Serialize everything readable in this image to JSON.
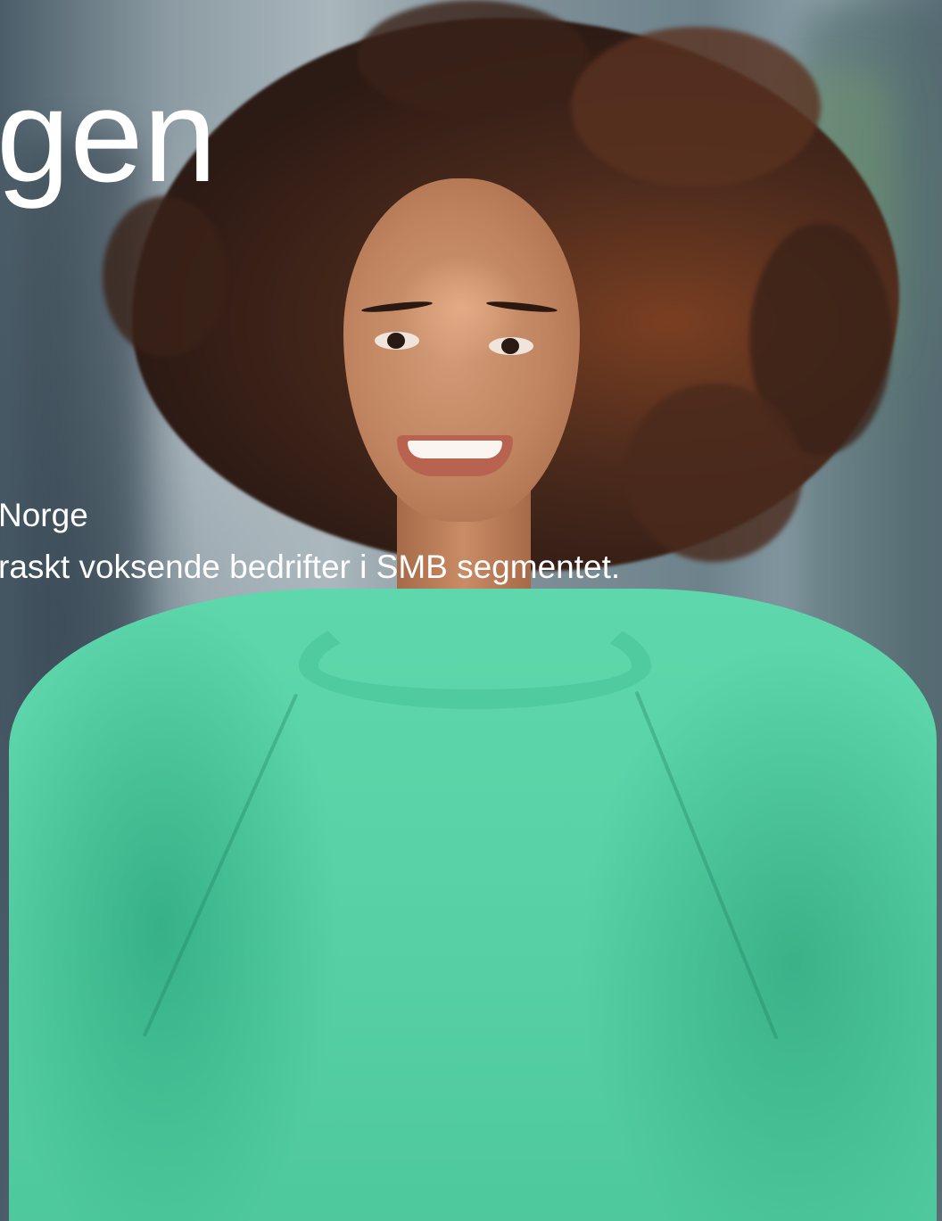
{
  "hero": {
    "headline": "gen",
    "line_1": "Norge",
    "line_2": "raskt voksende bedrifter i SMB segmentet.",
    "photo": "smiling-woman-in-green-sweater",
    "colors": {
      "text": "#ffffff",
      "sweater": "#5fd7ac",
      "hair": "#3a2218",
      "background": "#7f8f97"
    }
  }
}
